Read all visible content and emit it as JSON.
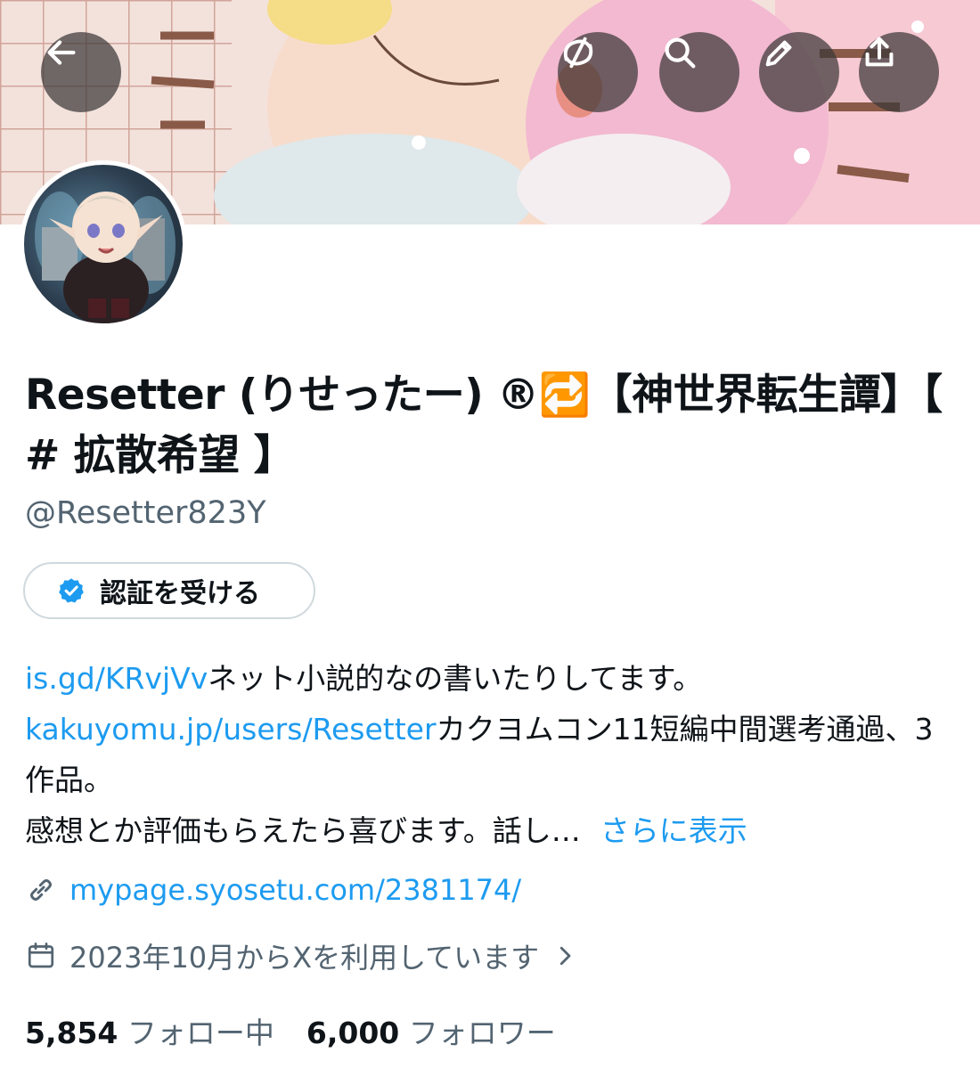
{
  "profile": {
    "display_name": "Resetter (りせったー) ®🔁【神世界転生譚】【 # 拡散希望 】",
    "handle": "@Resetter823Y",
    "verify_button": "認証を受ける",
    "bio": {
      "link1": "is.gd/KRvjVv",
      "text1": "ネット小説的なの書いたりしてます。",
      "link2": "kakuyomu.jp/users/Resetter",
      "text2": "カクヨムコン11短編中間選考通過、3作品。",
      "text3": "感想とか評価もらえたら喜びます。話し…",
      "more": "さらに表示"
    },
    "website": "mypage.syosetu.com/2381174/",
    "joined": "2023年10月からXを利用しています",
    "following_count": "5,854",
    "following_label": "フォロー中",
    "followers_count": "6,000",
    "followers_label": "フォロワー"
  },
  "colors": {
    "link": "#1d9bf0",
    "secondary_text": "#536471",
    "primary_text": "#0f1419",
    "verified_badge": "#1d9bf0"
  },
  "icons": {
    "back": "arrow-left-icon",
    "mute": "mute-icon",
    "search": "search-icon",
    "edit": "pencil-icon",
    "share": "share-icon",
    "verified": "verified-badge-icon",
    "website": "link-icon",
    "joined": "calendar-icon",
    "joined_chevron": "chevron-right-icon"
  }
}
